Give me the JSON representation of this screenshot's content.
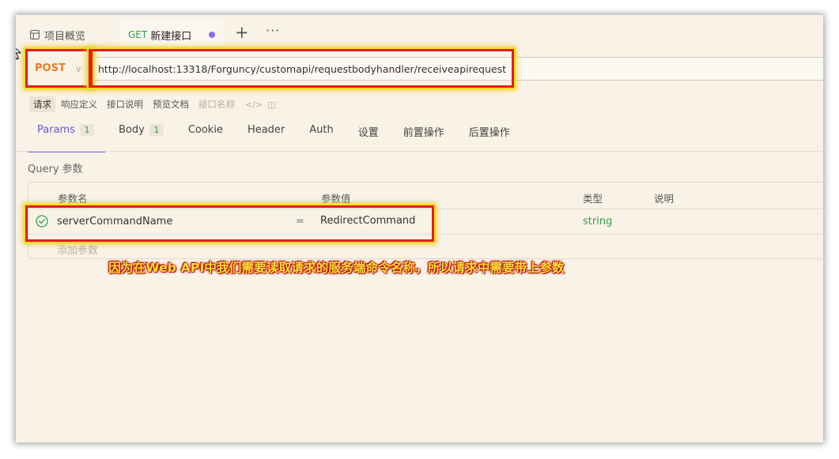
{
  "tabs": {
    "overview_label": "项目概览",
    "active_method": "GET",
    "active_label": "新建接口",
    "add_icon": "plus-icon",
    "more_icon": "more-icon"
  },
  "request": {
    "method": "POST",
    "url": "http://localhost:13318/Forguncy/customapi/requestbodyhandler/receiveapirequest"
  },
  "subtabs": [
    "请求",
    "响应定义",
    "接口说明",
    "预览文档",
    "接口名称"
  ],
  "param_tabs": [
    {
      "label": "Params",
      "badge": "1"
    },
    {
      "label": "Body",
      "badge": "1"
    },
    {
      "label": "Cookie"
    },
    {
      "label": "Header"
    },
    {
      "label": "Auth"
    },
    {
      "label": "设置"
    },
    {
      "label": "前置操作"
    },
    {
      "label": "后置操作"
    }
  ],
  "query": {
    "section_label": "Query 参数",
    "headers": {
      "name": "参数名",
      "value": "参数值",
      "type": "类型",
      "desc": "说明"
    },
    "rows": [
      {
        "name": "serverCommandName",
        "separator": "=",
        "value": "RedirectCommand",
        "type": "string",
        "desc": ""
      }
    ],
    "add_placeholder": "添加参数"
  },
  "annotation": "因为在Web API中我们需要读取请求的服务端命令名称，所以请求中需要带上参数",
  "colors": {
    "background": "#f9f2e7",
    "accent": "#6b58d6",
    "post": "#f07c24",
    "get": "#31a04b",
    "highlight_border": "#e11d1d",
    "highlight_glow": "#f4de1f"
  }
}
